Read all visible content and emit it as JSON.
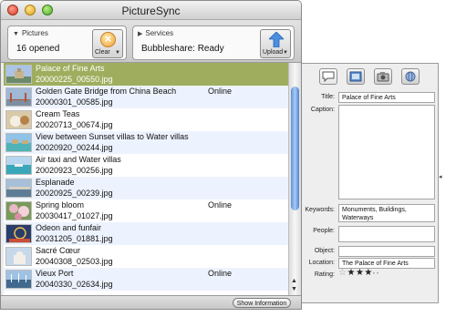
{
  "window": {
    "title": "PictureSync"
  },
  "pictures_panel": {
    "heading": "Pictures",
    "value": "16 opened",
    "button_label": "Clear"
  },
  "services_panel": {
    "heading": "Services",
    "value": "Bubbleshare: Ready",
    "button_label": "Upload"
  },
  "list": {
    "items": [
      {
        "title": "Palace of Fine Arts",
        "file": "20000225_00550.jpg",
        "status": "",
        "selected": true
      },
      {
        "title": "Golden Gate Bridge from China Beach",
        "file": "20000301_00585.jpg",
        "status": "Online"
      },
      {
        "title": "Cream Teas",
        "file": "20020713_00674.jpg",
        "status": ""
      },
      {
        "title": "View between Sunset villas to Water villas",
        "file": "20020920_00244.jpg",
        "status": ""
      },
      {
        "title": "Air taxi and Water villas",
        "file": "20020923_00256.jpg",
        "status": ""
      },
      {
        "title": "Esplanade",
        "file": "20020925_00239.jpg",
        "status": ""
      },
      {
        "title": "Spring bloom",
        "file": "20030417_01027.jpg",
        "status": "Online"
      },
      {
        "title": "Odeon and funfair",
        "file": "20031205_01881.jpg",
        "status": ""
      },
      {
        "title": "Sacré Cœur",
        "file": "20040308_02503.jpg",
        "status": ""
      },
      {
        "title": "Vieux Port",
        "file": "20040330_02634.jpg",
        "status": "Online"
      }
    ]
  },
  "statusbar": {
    "show_info_label": "Show Information"
  },
  "info": {
    "title_label": "Title:",
    "title_value": "Palace of Fine Arts",
    "caption_label": "Caption:",
    "caption_value": "",
    "keywords_label": "Keywords:",
    "keywords_value": "Monuments, Buildings, Waterways",
    "people_label": "People:",
    "people_value": "",
    "object_label": "Object:",
    "object_value": "",
    "location_label": "Location:",
    "location_value": "The Palace of Fine Arts",
    "rating_label": "Rating:",
    "rating_value": 3,
    "rating_max": 5
  },
  "icons": [
    "speech-bubble-icon",
    "pictures-icon",
    "camera-icon",
    "globe-icon",
    "clear-icon",
    "upload-icon"
  ],
  "colors": {
    "selection": "#9fae5e",
    "alt_row": "#edf3fe",
    "scroll_thumb": "#6a9de0"
  }
}
